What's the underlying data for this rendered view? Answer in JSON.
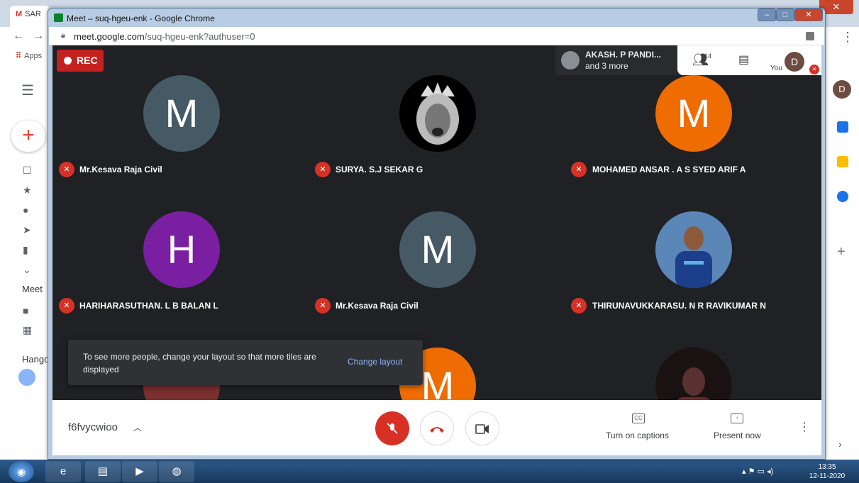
{
  "background_window": {
    "tab_title": "SAR",
    "gmail_letter": "M",
    "nav_back": "←",
    "nav_forward": "→",
    "apps_label": "Apps",
    "meet_section": "Meet",
    "hangouts_section": "Hango",
    "user_initial": "D",
    "close_glyph": "✕",
    "more_glyph": "⋮",
    "plus_glyph": "+",
    "chevron_glyph": "›"
  },
  "window": {
    "title": "Meet – suq-hgeu-enk - Google Chrome",
    "url_host": "meet.google.com",
    "url_path": "/suq-hgeu-enk?authuser=0",
    "minimize": "–",
    "maximize": "□",
    "close": "✕"
  },
  "meet": {
    "rec_label": "REC",
    "presenter_name": "AKASH. P PANDI...",
    "presenter_more": "and 3 more",
    "people_count": "14",
    "you_label": "You",
    "you_initial": "D",
    "tiles": [
      {
        "name": "Mr.Kesava Raja Civil",
        "initial": "M",
        "color": "#455a64"
      },
      {
        "name": "SURYA. S.J SEKAR G",
        "initial": "",
        "color": "#000000"
      },
      {
        "name": "MOHAMED ANSAR . A S SYED ARIF A",
        "initial": "M",
        "color": "#ef6c00"
      },
      {
        "name": "HARIHARASUTHAN. L B BALAN L",
        "initial": "H",
        "color": "#7b1fa2"
      },
      {
        "name": "Mr.Kesava Raja Civil",
        "initial": "M",
        "color": "#455a64"
      },
      {
        "name": "THIRUNAVUKKARASU. N R RAVIKUMAR N",
        "initial": "",
        "color": "#1f4b7a"
      },
      {
        "name": "",
        "initial": "",
        "color": "#7a2e2e"
      },
      {
        "name": "",
        "initial": "M",
        "color": "#ef6c00"
      },
      {
        "name": "",
        "initial": "",
        "color": "#3a2a2a"
      }
    ],
    "toast_message": "To see more people, change your layout so that more tiles are displayed",
    "toast_action": "Change layout",
    "meeting_code": "f6fvycwioo",
    "captions_label": "Turn on captions",
    "captions_icon_text": "CC",
    "present_label": "Present now",
    "present_icon_text": "↑",
    "more_glyph": "⋮"
  },
  "taskbar": {
    "time": "13:35",
    "date": "12-11-2020"
  }
}
